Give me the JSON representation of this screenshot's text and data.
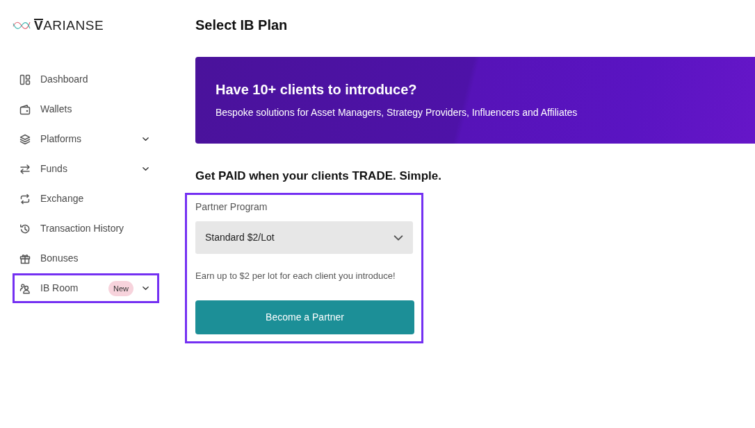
{
  "logo": {
    "text": "VARIANSE"
  },
  "sidebar": {
    "items": [
      {
        "label": "Dashboard",
        "expandable": false,
        "highlighted": false
      },
      {
        "label": "Wallets",
        "expandable": false,
        "highlighted": false
      },
      {
        "label": "Platforms",
        "expandable": true,
        "highlighted": false
      },
      {
        "label": "Funds",
        "expandable": true,
        "highlighted": false
      },
      {
        "label": "Exchange",
        "expandable": false,
        "highlighted": false
      },
      {
        "label": "Transaction History",
        "expandable": false,
        "highlighted": false
      },
      {
        "label": "Bonuses",
        "expandable": false,
        "highlighted": false
      },
      {
        "label": "IB Room",
        "badge": "New",
        "expandable": true,
        "highlighted": true
      }
    ]
  },
  "page": {
    "title": "Select IB Plan"
  },
  "banner": {
    "title": "Have 10+ clients to introduce?",
    "subtitle": "Bespoke solutions for Asset Managers, Strategy Providers, Influencers and Affiliates"
  },
  "section_heading": "Get PAID when your clients TRADE. Simple.",
  "partner_panel": {
    "highlighted": true,
    "label": "Partner Program",
    "selected_program": "Standard $2/Lot",
    "note": "Earn up to $2 per lot for each client you introduce!",
    "button": "Become a Partner"
  }
}
